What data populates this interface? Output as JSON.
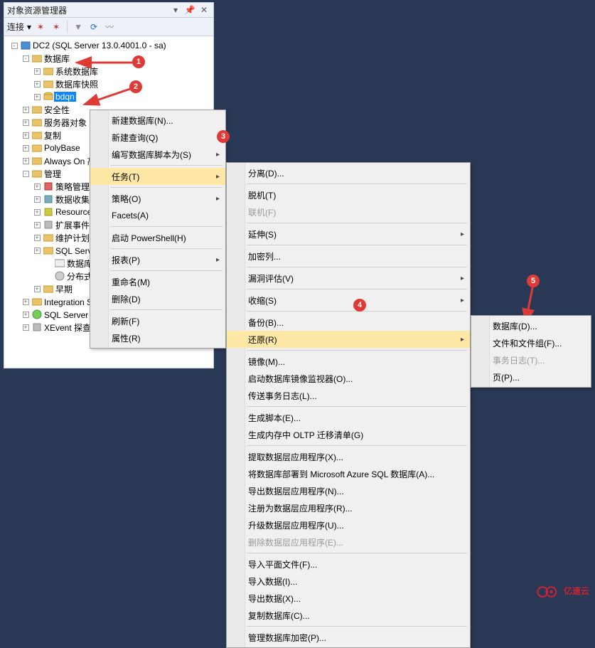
{
  "panel": {
    "title": "对象资源管理器",
    "toolbar": {
      "connect_label": "连接"
    }
  },
  "tree": {
    "root": "DC2 (SQL Server 13.0.4001.0 - sa)",
    "databases": "数据库",
    "sys_db": "系统数据库",
    "db_snap": "数据库快照",
    "bdqn": "bdqn",
    "security": "安全性",
    "server_objects": "服务器对象",
    "replication": "复制",
    "polybase": "PolyBase",
    "alwayson": "Always On 高可用性",
    "management": "管理",
    "policy_mgmt": "策略管理",
    "data_collection": "数据收集",
    "res_gov": "Resource Governor",
    "ext_events": "扩展事件",
    "maint_plans": "维护计划",
    "sql_logs": "SQL Server 日志",
    "db_mail": "数据库邮件",
    "dtc": "分布式事务处理协调器",
    "legacy": "早期",
    "ssis": "Integration Services 目录",
    "agent": "SQL Server 代理",
    "xevent": "XEvent 探查器"
  },
  "menu1": {
    "new_db": "新建数据库(N)...",
    "new_query": "新建查询(Q)",
    "script_db_as": "编写数据库脚本为(S)",
    "tasks": "任务(T)",
    "policies": "策略(O)",
    "facets": "Facets(A)",
    "start_ps": "启动 PowerShell(H)",
    "reports": "报表(P)",
    "rename": "重命名(M)",
    "delete": "删除(D)",
    "refresh": "刷新(F)",
    "properties": "属性(R)"
  },
  "menu2": {
    "detach": "分离(D)...",
    "take_offline": "脱机(T)",
    "bring_online": "联机(F)",
    "stretch": "延伸(S)",
    "encrypt_cols": "加密列...",
    "vuln_assess": "漏洞评估(V)",
    "shrink": "收缩(S)",
    "backup": "备份(B)...",
    "restore": "还原(R)",
    "mirror": "镜像(M)...",
    "launch_mirror_monitor": "启动数据库镜像监视器(O)...",
    "ship_logs": "传送事务日志(L)...",
    "gen_scripts": "生成脚本(E)...",
    "gen_oltp_migration": "生成内存中 OLTP 迁移清单(G)",
    "extract_dacpac": "提取数据层应用程序(X)...",
    "deploy_azure": "将数据库部署到 Microsoft Azure SQL 数据库(A)...",
    "export_dacpac": "导出数据层应用程序(N)...",
    "register_dacpac": "注册为数据层应用程序(R)...",
    "upgrade_dacpac": "升级数据层应用程序(U)...",
    "delete_dacpac": "删除数据层应用程序(E)...",
    "import_flat": "导入平面文件(F)...",
    "import_data": "导入数据(I)...",
    "export_data": "导出数据(X)...",
    "copy_db": "复制数据库(C)...",
    "manage_db_encrypt": "管理数据库加密(P)..."
  },
  "menu3": {
    "database": "数据库(D)...",
    "files_groups": "文件和文件组(F)...",
    "transaction_log": "事务日志(T)...",
    "page": "页(P)..."
  },
  "callouts": {
    "c1": "1",
    "c2": "2",
    "c3": "3",
    "c4": "4",
    "c5": "5"
  },
  "watermark": "亿速云"
}
